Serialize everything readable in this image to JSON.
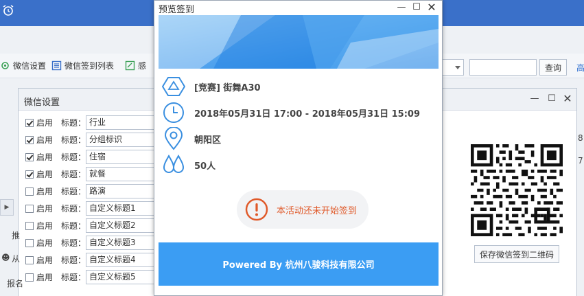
{
  "app": {
    "toolbar": {
      "wechat_settings": "微信设置",
      "wechat_checkin_list": "微信签到列表",
      "partial_label": "感",
      "search_value": "",
      "query_button": "查询",
      "advanced_partial": "高"
    }
  },
  "wechat_dialog": {
    "title": "微信设置",
    "enable_label": "启用",
    "title_label": "标题：",
    "rows": [
      {
        "checked": true,
        "value": "行业"
      },
      {
        "checked": true,
        "value": "分组标识"
      },
      {
        "checked": true,
        "value": "住宿"
      },
      {
        "checked": true,
        "value": "就餐"
      },
      {
        "checked": false,
        "value": "路演"
      },
      {
        "checked": false,
        "value": "自定义标题1"
      },
      {
        "checked": false,
        "value": "自定义标题2"
      },
      {
        "checked": false,
        "value": "自定义标题3"
      },
      {
        "checked": false,
        "value": "自定义标题4"
      },
      {
        "checked": false,
        "value": "自定义标题5"
      }
    ],
    "side_fragments": {
      "a": "推",
      "b": "从",
      "c": "报名"
    },
    "right_digits": {
      "a": "8",
      "b": "7"
    },
    "save_qr_button": "保存微信签到二维码"
  },
  "preview": {
    "title": "预览签到",
    "event_name": "[竞赛] 街舞A30",
    "time_range": "2018年05月31日 17:00 - 2018年05月31日 15:09",
    "location": "朝阳区",
    "attendees": "50人",
    "status": "本活动还未开始签到",
    "footer": "Powered By 杭州八骏科技有限公司"
  },
  "colors": {
    "accent_blue": "#3b9df3",
    "icon_blue": "#3a8fe0",
    "status_orange": "#e05a2a",
    "app_header_blue": "#3a70c9"
  }
}
